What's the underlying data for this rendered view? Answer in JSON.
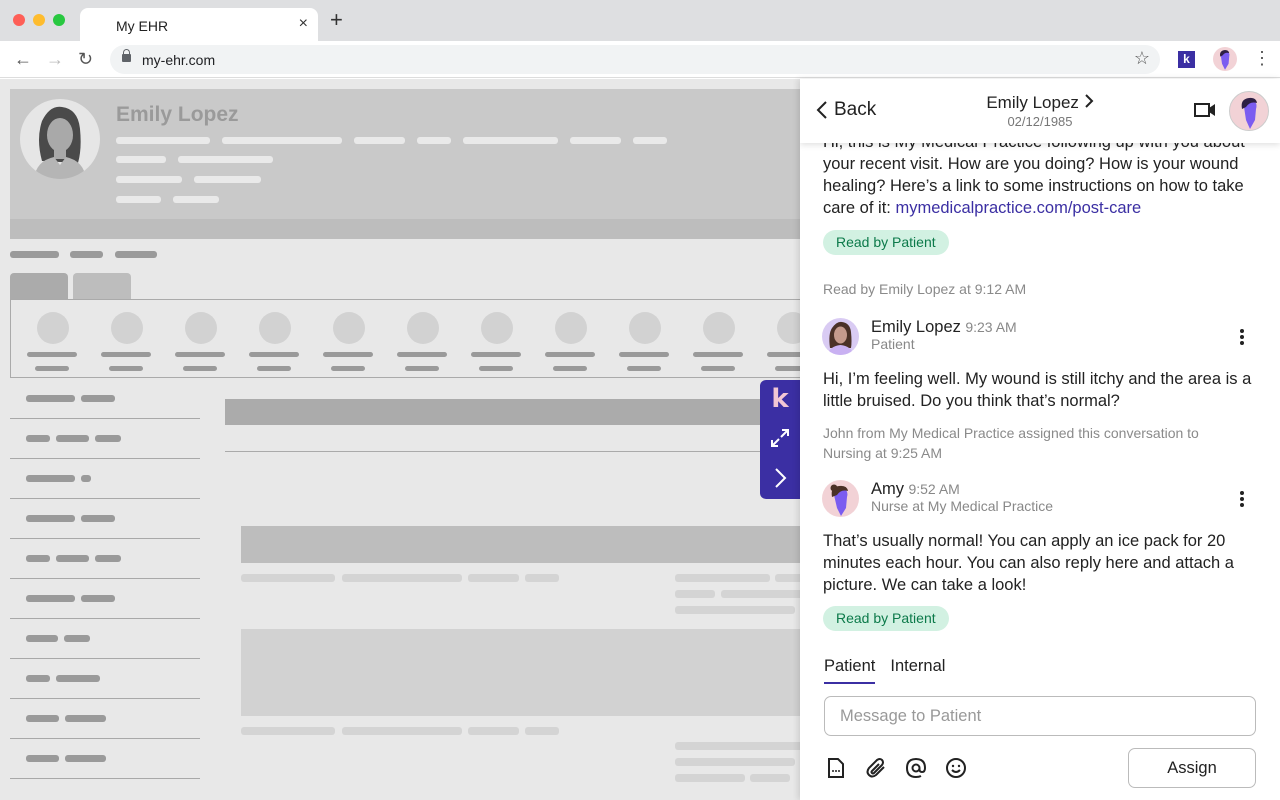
{
  "browser": {
    "tab_title": "My EHR",
    "tab_close": "×",
    "new_tab": "+",
    "url": "my-ehr.com",
    "back": "←",
    "forward": "→",
    "reload": "↻",
    "bookmark": "☆",
    "extension_label": "k",
    "menu": "⋮"
  },
  "ehr": {
    "patient_name": "Emily Lopez"
  },
  "widget": {
    "logo": "k"
  },
  "chat": {
    "header": {
      "back_label": "Back",
      "patient_name": "Emily Lopez",
      "patient_dob": "02/12/1985"
    },
    "messages": {
      "first": {
        "text": "Hi, this is My Medical Practice following up with you about your recent visit. How are you doing? How is your wound healing? Here’s a link to some instructions on how to take care of it: ",
        "link": "mymedicalpractice.com/post-care",
        "badge": "Read by Patient"
      },
      "read_notice": "Read by Emily Lopez at 9:12 AM",
      "patient_msg": {
        "sender": "Emily Lopez",
        "time": "9:23 AM",
        "role": "Patient",
        "text": "Hi, I’m feeling well. My wound is still itchy and the area is a little bruised. Do you think that’s normal?"
      },
      "assign_notice": "John from My Medical Practice assigned this conversation to Nursing at 9:25 AM",
      "nurse_msg": {
        "sender": "Amy",
        "time": "9:52 AM",
        "role": "Nurse at My Medical Practice",
        "text": "That’s usually normal! You can apply an ice pack for 20 minutes each hour. You can also reply here and attach a picture. We can take a look!",
        "badge": "Read by Patient"
      }
    },
    "composer": {
      "tabs": [
        {
          "label": "Patient",
          "active": true
        },
        {
          "label": "Internal",
          "active": false
        }
      ],
      "placeholder": "Message to Patient",
      "value": "",
      "assign_label": "Assign"
    },
    "colors": {
      "accent": "#3b2fa3",
      "badge_bg": "#d2f1e2",
      "badge_text": "#0c7a4a"
    }
  }
}
